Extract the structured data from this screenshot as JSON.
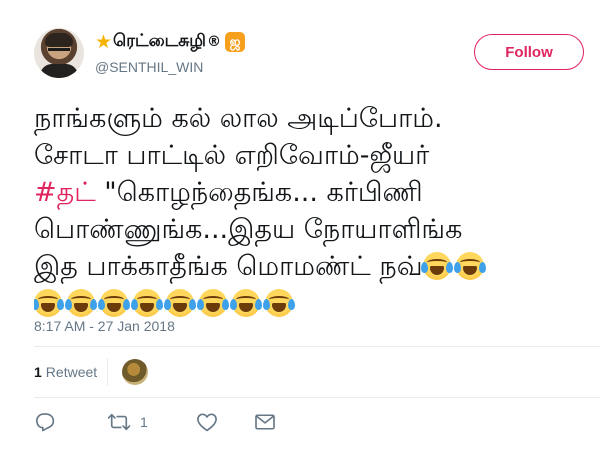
{
  "author": {
    "display_name": "ரெட்டைசுழி",
    "registered_mark": "®",
    "badge_glyph": "ஜ",
    "badge_color": "#F7A01E",
    "handle": "@SENTHIL_WIN",
    "star_icon": "star-icon"
  },
  "follow_button": {
    "label": "Follow",
    "accent": "#E0245E"
  },
  "tweet": {
    "line1": "நாங்களும் கல் லால அடிப்போம்.",
    "line2": "சோடா பாட்டில் எறிவோம்-ஜீயர்",
    "hashtag": "#தட்",
    "line3_rest": " \"கொழந்தைங்க... கர்பிணி",
    "line4": "பொண்ணுங்க...இதய நோயாளிங்க",
    "line5": "இத பாக்காதீங்க மொமண்ட் நவ்",
    "emoji_name": "face-with-tears-of-joy",
    "emoji_count_line5": 2,
    "emoji_count_line6": 8
  },
  "timestamp": "8:17 AM - 27 Jan 2018",
  "stats": {
    "retweet_count": "1",
    "retweet_label": "Retweet"
  },
  "actions": {
    "reply_icon": "reply-icon",
    "retweet_icon": "retweet-icon",
    "retweet_count": "1",
    "like_icon": "heart-icon",
    "message_icon": "envelope-icon"
  },
  "colors": {
    "text": "#14171A",
    "secondary": "#657786",
    "hashtag": "#E0245E",
    "divider": "#E6ECF0"
  }
}
